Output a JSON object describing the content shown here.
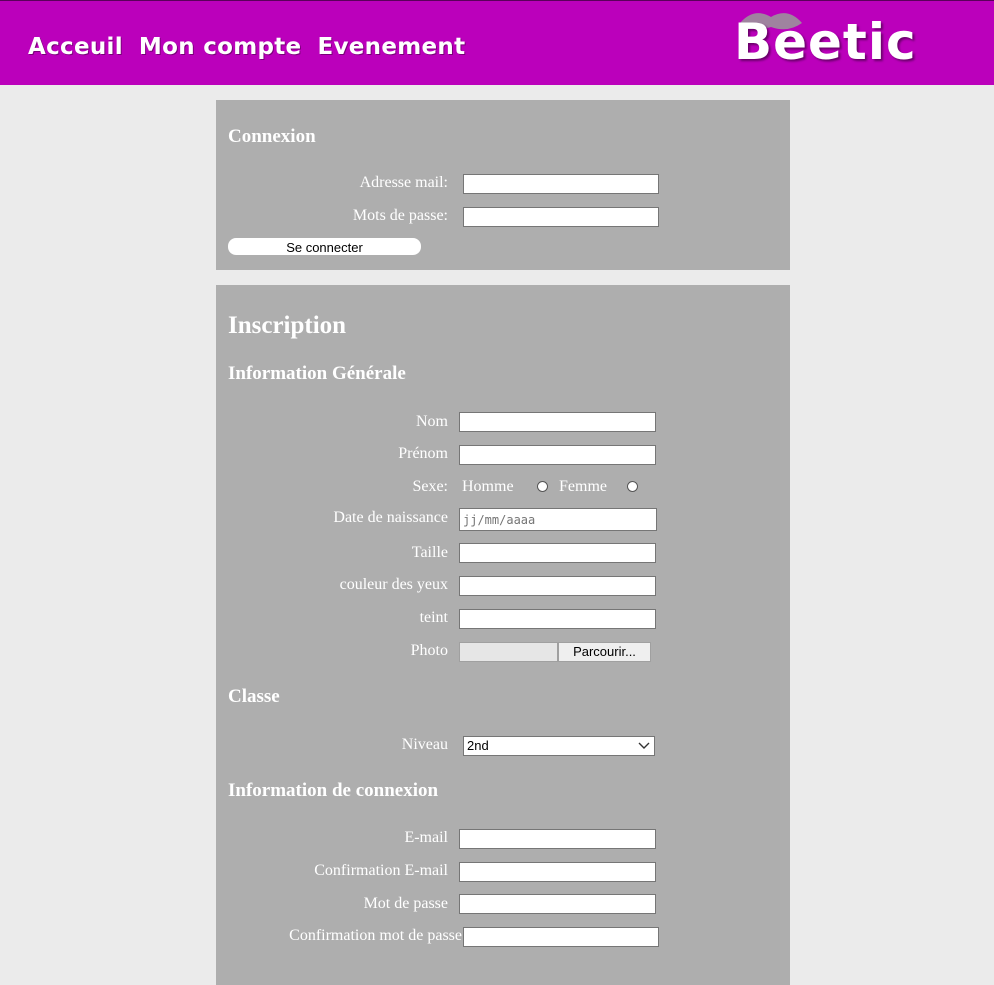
{
  "nav": {
    "items": [
      "Acceuil",
      "Mon compte",
      "Evenement"
    ]
  },
  "brand": {
    "name": "Beetic",
    "accent": "#bb00bb"
  },
  "login": {
    "title": "Connexion",
    "email_label": "Adresse mail:",
    "email_value": "",
    "password_label": "Mots de passe:",
    "password_value": "",
    "submit_label": "Se connecter"
  },
  "signup": {
    "title": "Inscription",
    "general": {
      "title": "Information Générale",
      "nom_label": "Nom",
      "prenom_label": "Prénom",
      "sexe_label": "Sexe:",
      "sexe_options": [
        "Homme",
        "Femme"
      ],
      "birth_label": "Date de naissance",
      "birth_placeholder": "jj/mm/aaaa",
      "taille_label": "Taille",
      "yeux_label": "couleur des yeux",
      "teint_label": "teint",
      "photo_label": "Photo",
      "photo_button": "Parcourir..."
    },
    "classe": {
      "title": "Classe",
      "niveau_label": "Niveau",
      "niveau_value": "2nd"
    },
    "connexion": {
      "title": "Information de connexion",
      "email_label": "E-mail",
      "email_confirm_label": "Confirmation E-mail",
      "password_label": "Mot de passe",
      "password_confirm_label": "Confirmation mot de passe"
    }
  }
}
